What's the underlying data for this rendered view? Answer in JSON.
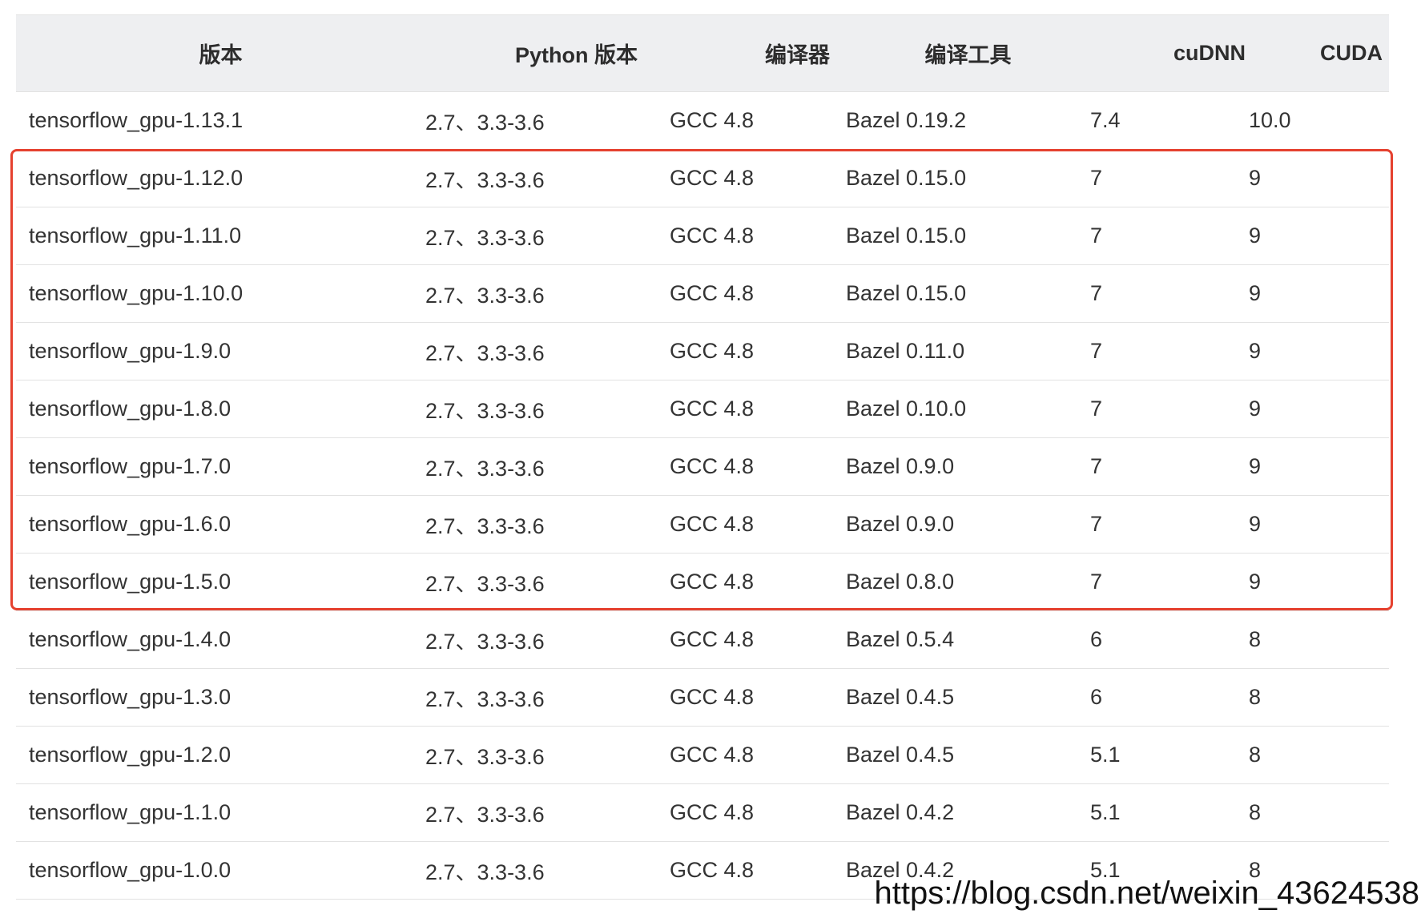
{
  "table": {
    "headers": [
      "版本",
      "Python 版本",
      "编译器",
      "编译工具",
      "cuDNN",
      "CUDA"
    ],
    "rows": [
      [
        "tensorflow_gpu-1.13.1",
        "2.7、3.3-3.6",
        "GCC 4.8",
        "Bazel 0.19.2",
        "7.4",
        "10.0"
      ],
      [
        "tensorflow_gpu-1.12.0",
        "2.7、3.3-3.6",
        "GCC 4.8",
        "Bazel 0.15.0",
        "7",
        "9"
      ],
      [
        "tensorflow_gpu-1.11.0",
        "2.7、3.3-3.6",
        "GCC 4.8",
        "Bazel 0.15.0",
        "7",
        "9"
      ],
      [
        "tensorflow_gpu-1.10.0",
        "2.7、3.3-3.6",
        "GCC 4.8",
        "Bazel 0.15.0",
        "7",
        "9"
      ],
      [
        "tensorflow_gpu-1.9.0",
        "2.7、3.3-3.6",
        "GCC 4.8",
        "Bazel 0.11.0",
        "7",
        "9"
      ],
      [
        "tensorflow_gpu-1.8.0",
        "2.7、3.3-3.6",
        "GCC 4.8",
        "Bazel 0.10.0",
        "7",
        "9"
      ],
      [
        "tensorflow_gpu-1.7.0",
        "2.7、3.3-3.6",
        "GCC 4.8",
        "Bazel 0.9.0",
        "7",
        "9"
      ],
      [
        "tensorflow_gpu-1.6.0",
        "2.7、3.3-3.6",
        "GCC 4.8",
        "Bazel 0.9.0",
        "7",
        "9"
      ],
      [
        "tensorflow_gpu-1.5.0",
        "2.7、3.3-3.6",
        "GCC 4.8",
        "Bazel 0.8.0",
        "7",
        "9"
      ],
      [
        "tensorflow_gpu-1.4.0",
        "2.7、3.3-3.6",
        "GCC 4.8",
        "Bazel 0.5.4",
        "6",
        "8"
      ],
      [
        "tensorflow_gpu-1.3.0",
        "2.7、3.3-3.6",
        "GCC 4.8",
        "Bazel 0.4.5",
        "6",
        "8"
      ],
      [
        "tensorflow_gpu-1.2.0",
        "2.7、3.3-3.6",
        "GCC 4.8",
        "Bazel 0.4.5",
        "5.1",
        "8"
      ],
      [
        "tensorflow_gpu-1.1.0",
        "2.7、3.3-3.6",
        "GCC 4.8",
        "Bazel 0.4.2",
        "5.1",
        "8"
      ],
      [
        "tensorflow_gpu-1.0.0",
        "2.7、3.3-3.6",
        "GCC 4.8",
        "Bazel 0.4.2",
        "5.1",
        "8"
      ]
    ]
  },
  "highlight": {
    "color": "#e5412f"
  },
  "watermark": {
    "text": "https://blog.csdn.net/weixin_43624538"
  }
}
